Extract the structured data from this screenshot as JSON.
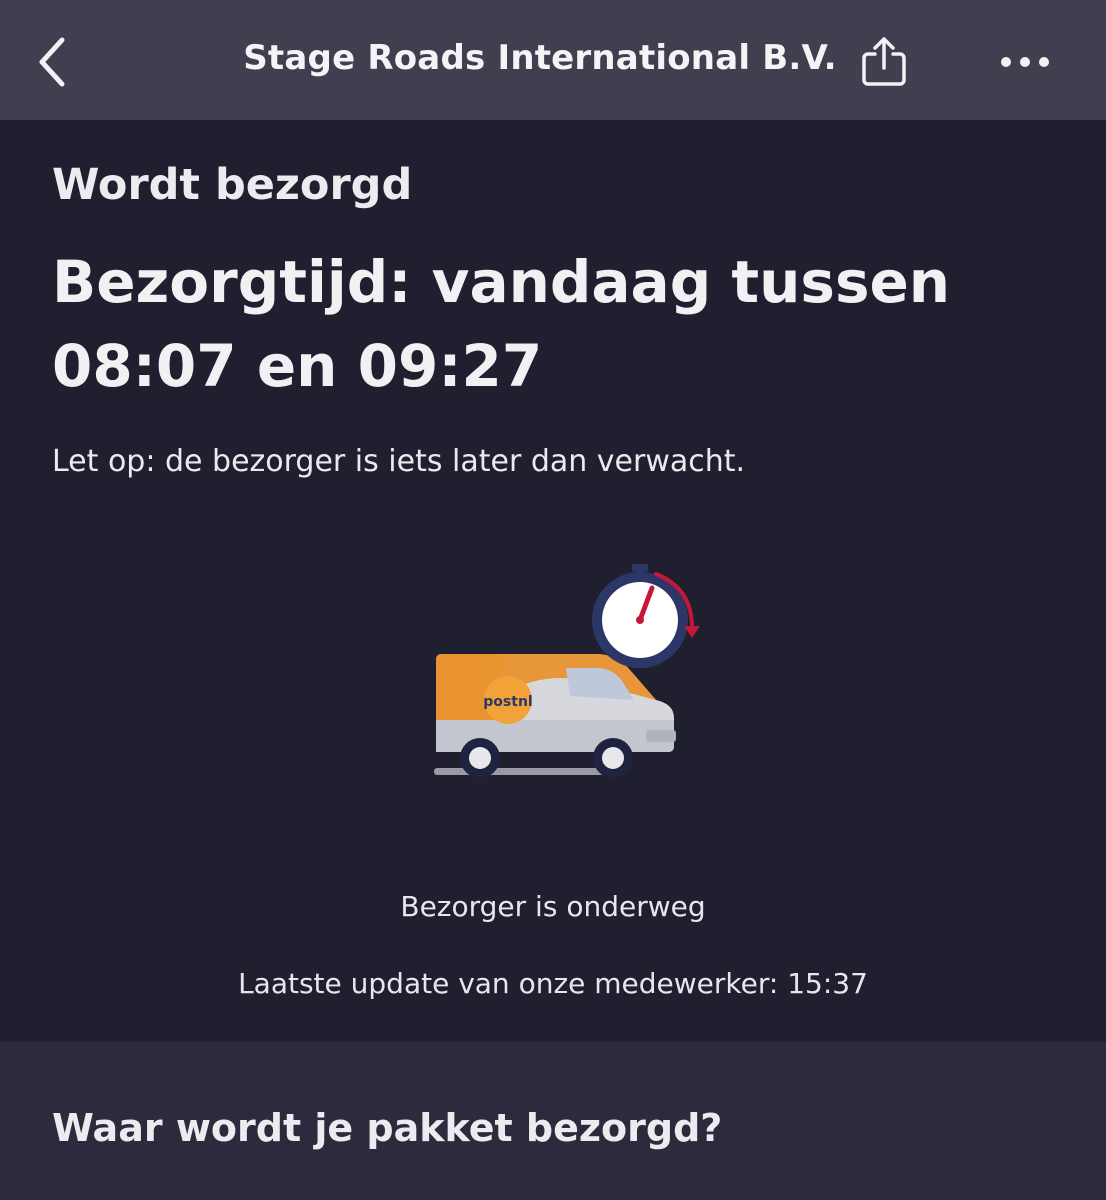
{
  "header": {
    "title": "Stage Roads International B.V.",
    "back_icon": "chevron-left-icon",
    "share_icon": "share-icon",
    "more_icon": "more-horizontal-icon"
  },
  "status": {
    "label": "Wordt bezorgd",
    "delivery_time": "Bezorgtijd: vandaag tussen 08:07 en 09:27",
    "notice": "Let op: de bezorger is iets later dan verwacht.",
    "illustration_brand": "postnl",
    "courier_status": "Bezorger is onderweg",
    "last_update": "Laatste update van onze medewerker: 15:37"
  },
  "location": {
    "heading": "Waar wordt je pakket bezorgd?"
  },
  "colors": {
    "header_bg": "#3f3f50",
    "page_bg": "#1f1f2f",
    "section_bg": "#2b2b3d",
    "postnl_orange": "#e8932f",
    "stopwatch_navy": "#2c3768",
    "alert_red": "#c8163a"
  }
}
